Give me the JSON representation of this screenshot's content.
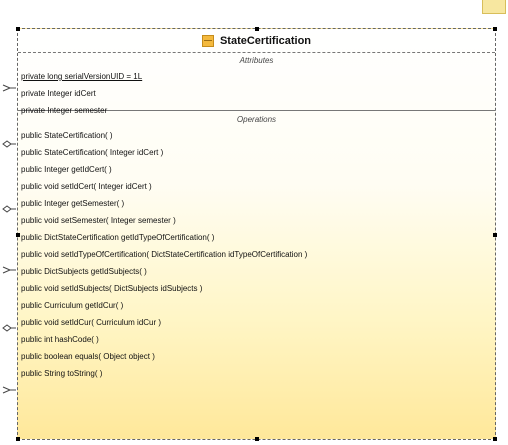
{
  "diagram": {
    "class_name": "StateCertification",
    "attributes_heading": "Attributes",
    "operations_heading": "Operations",
    "attributes": [
      "private long serialVersionUID = 1L",
      "private Integer idCert",
      "private Integer semester"
    ],
    "operations": [
      "public StateCertification( )",
      "public StateCertification( Integer idCert )",
      "public Integer  getIdCert( )",
      "public void  setIdCert( Integer idCert )",
      "public Integer  getSemester( )",
      "public void  setSemester( Integer semester )",
      "public DictStateCertification  getIdTypeOfCertification( )",
      "public void  setIdTypeOfCertification( DictStateCertification idTypeOfCertification )",
      "public DictSubjects  getIdSubjects( )",
      "public void  setIdSubjects( DictSubjects idSubjects )",
      "public Curriculum  getIdCur( )",
      "public void  setIdCur( Curriculum idCur )",
      "public int  hashCode( )",
      "public boolean  equals( Object object )",
      "public String  toString( )"
    ]
  },
  "colors": {
    "class_icon": "#f4b93d",
    "gradient_end": "#ffe89a",
    "border": "#666666"
  },
  "icons": {
    "class_icon": "class-icon",
    "association_end": "arrow-association-icon",
    "aggregation_end": "diamond-aggregation-icon"
  }
}
